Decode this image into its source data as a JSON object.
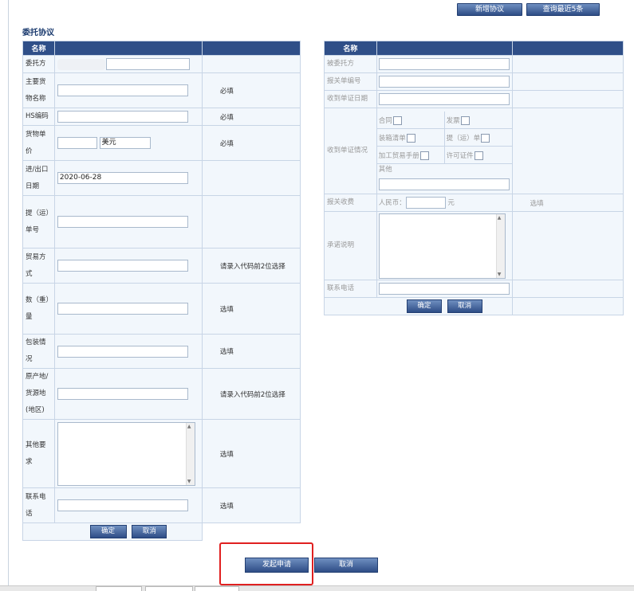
{
  "toolbar": {
    "new_agreement": "新增协议",
    "query_recent": "查询最近5条"
  },
  "section_title": "委托协议",
  "left_table": {
    "header_name": "名称",
    "rows": {
      "consignor": {
        "label": "委托方",
        "value": ""
      },
      "goods_name": {
        "label": "主要货物名称",
        "hint": "必填"
      },
      "hs_code": {
        "label": "HS编码",
        "hint": "必填"
      },
      "unit_price": {
        "label": "货物单价",
        "currency": "美元",
        "hint": "必填"
      },
      "date": {
        "label": "进/出口日期",
        "value": "2020-06-28"
      },
      "bill": {
        "label": "提（运）单号"
      },
      "trade_mode": {
        "label": "贸易方式",
        "hint": "请录入代码前2位选择"
      },
      "quantity": {
        "label": "数（重）量",
        "hint": "选填"
      },
      "packing": {
        "label": "包装情况",
        "hint": "选填"
      },
      "origin": {
        "label": "原产地/货源地(地区)",
        "hint": "请录入代码前2位选择"
      },
      "other": {
        "label": "其他要求",
        "hint": "选填"
      },
      "phone": {
        "label": "联系电话",
        "hint": "选填"
      }
    },
    "confirm": "确定",
    "cancel": "取消"
  },
  "right_table": {
    "header_name": "名称",
    "rows": {
      "entrusted": {
        "label": "被委托方"
      },
      "decl_no": {
        "label": "报关单编号"
      },
      "recv_date": {
        "label": "收到单证日期"
      },
      "recv_status": {
        "label": "收到单证情况",
        "contract": "合同",
        "invoice": "发票",
        "packing_list": "装箱清单",
        "bill": "提（运）单",
        "processing_manual": "加工贸易手册",
        "license": "许可证件",
        "other": "其他"
      },
      "fee": {
        "label": "报关收费",
        "rmb": "人民币：",
        "unit": "元",
        "hint": "选填"
      },
      "promise": {
        "label": "承诺说明"
      },
      "phone": {
        "label": "联系电话"
      }
    },
    "confirm": "确定",
    "cancel": "取消"
  },
  "footer": {
    "submit": "发起申请",
    "cancel": "取消"
  }
}
